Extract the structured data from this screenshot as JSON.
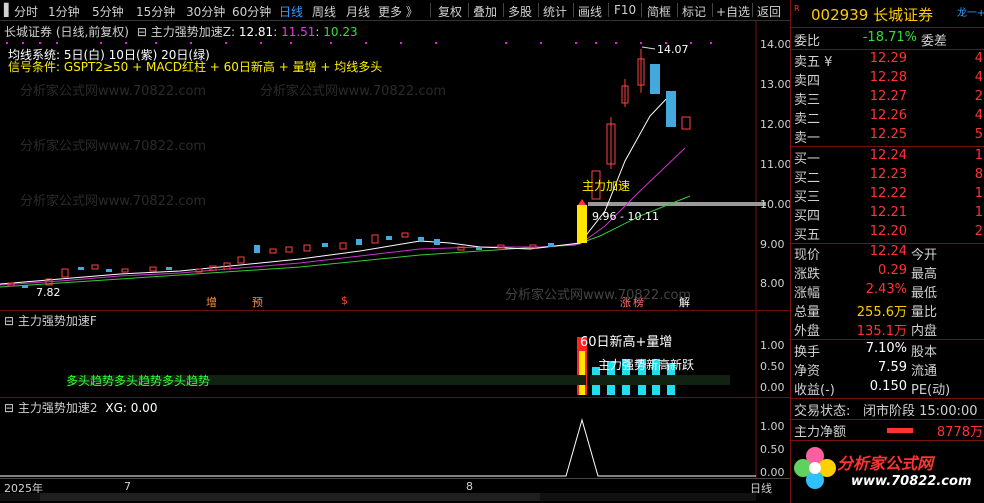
{
  "toolbar": {
    "periods": [
      "分时",
      "1分钟",
      "5分钟",
      "15分钟",
      "30分钟",
      "60分钟",
      "日线",
      "周线",
      "月线",
      "更多 》"
    ],
    "active_period": "日线",
    "tools": [
      "复权",
      "叠加",
      "多股",
      "统计",
      "画线",
      "F10",
      "简框",
      "标记",
      "+自选",
      "返回"
    ]
  },
  "main_panel": {
    "stock_title": "长城证券 (日线,前复权)",
    "indicator_name": "主力强势加速Z",
    "value_white": "12.81",
    "value_magenta": "11.51",
    "value_green": "10.23",
    "ma_label": "均线系统: 5日(白) 10日(紫) 20日(绿)",
    "signal_label": "信号条件: GSPT2≥50 + MACD红柱 + 60日新高 + 量增 + 均线多头",
    "annotation_high": "14.07",
    "annotation_low": "7.82",
    "annotation_signal": "主力加速",
    "annotation_range": "9.96 - 10.11",
    "bottom_marks": [
      "增",
      "预",
      "$",
      "涨",
      "榜",
      "解"
    ],
    "axis": [
      "14.00",
      "13.00",
      "12.00",
      "11.00",
      "10.00",
      "9.00",
      "8.00"
    ]
  },
  "panel_f": {
    "title": "主力强势加速F",
    "label_top": "60日新高+量增",
    "label_right": "主力强势新高新跃",
    "label_left": "多头趋势多头趋势多头趋势",
    "axis": [
      "1.00",
      "0.50",
      "0.00"
    ]
  },
  "panel_xg": {
    "title": "主力强势加速2",
    "value": "XG: 0.00",
    "axis": [
      "1.00",
      "0.50",
      "0.00"
    ]
  },
  "time_axis": {
    "year": "2025年",
    "m7": "7",
    "m8": "8",
    "period": "日线"
  },
  "watermark": "分析家公式网www.70822.com",
  "quote": {
    "flag": "R",
    "code_line": "002939 长城证券",
    "corner": "龙一+证",
    "weibi_label": "委比",
    "weibi_value": "-18.71%",
    "weicha_label": "委差",
    "sells": [
      {
        "label": "卖五 ¥",
        "price": "12.29",
        "vol": "4"
      },
      {
        "label": "卖四",
        "price": "12.28",
        "vol": "4"
      },
      {
        "label": "卖三",
        "price": "12.27",
        "vol": "2"
      },
      {
        "label": "卖二",
        "price": "12.26",
        "vol": "4"
      },
      {
        "label": "卖一",
        "price": "12.25",
        "vol": "5"
      }
    ],
    "buys": [
      {
        "label": "买一",
        "price": "12.24",
        "vol": "1"
      },
      {
        "label": "买二",
        "price": "12.23",
        "vol": "8"
      },
      {
        "label": "买三",
        "price": "12.22",
        "vol": "1"
      },
      {
        "label": "买四",
        "price": "12.21",
        "vol": "1"
      },
      {
        "label": "买五",
        "price": "12.20",
        "vol": "2"
      }
    ],
    "stats": [
      {
        "label": "现价",
        "value": "12.24",
        "label2": "今开",
        "value2": ""
      },
      {
        "label": "涨跌",
        "value": "0.29",
        "label2": "最高",
        "value2": ""
      },
      {
        "label": "涨幅",
        "value": "2.43%",
        "label2": "最低",
        "value2": ""
      },
      {
        "label": "总量",
        "value": "255.6万",
        "label2": "量比",
        "value2": ""
      },
      {
        "label": "外盘",
        "value": "135.1万",
        "label2": "内盘",
        "value2": ""
      }
    ],
    "stats2": [
      {
        "label": "换手",
        "value": "7.10%",
        "label2": "股本",
        "value2": ""
      },
      {
        "label": "净资",
        "value": "7.59",
        "label2": "流通",
        "value2": ""
      },
      {
        "label": "收益(-)",
        "value": "0.150",
        "label2": "PE(动)",
        "value2": ""
      }
    ],
    "trade_status_label": "交易状态:",
    "trade_status_value": "闭市阶段 15:00:00",
    "net_label": "主力净额",
    "net_value": "8778万",
    "logo_text": "分析家公式网",
    "logo_url": "www.70822.com"
  }
}
